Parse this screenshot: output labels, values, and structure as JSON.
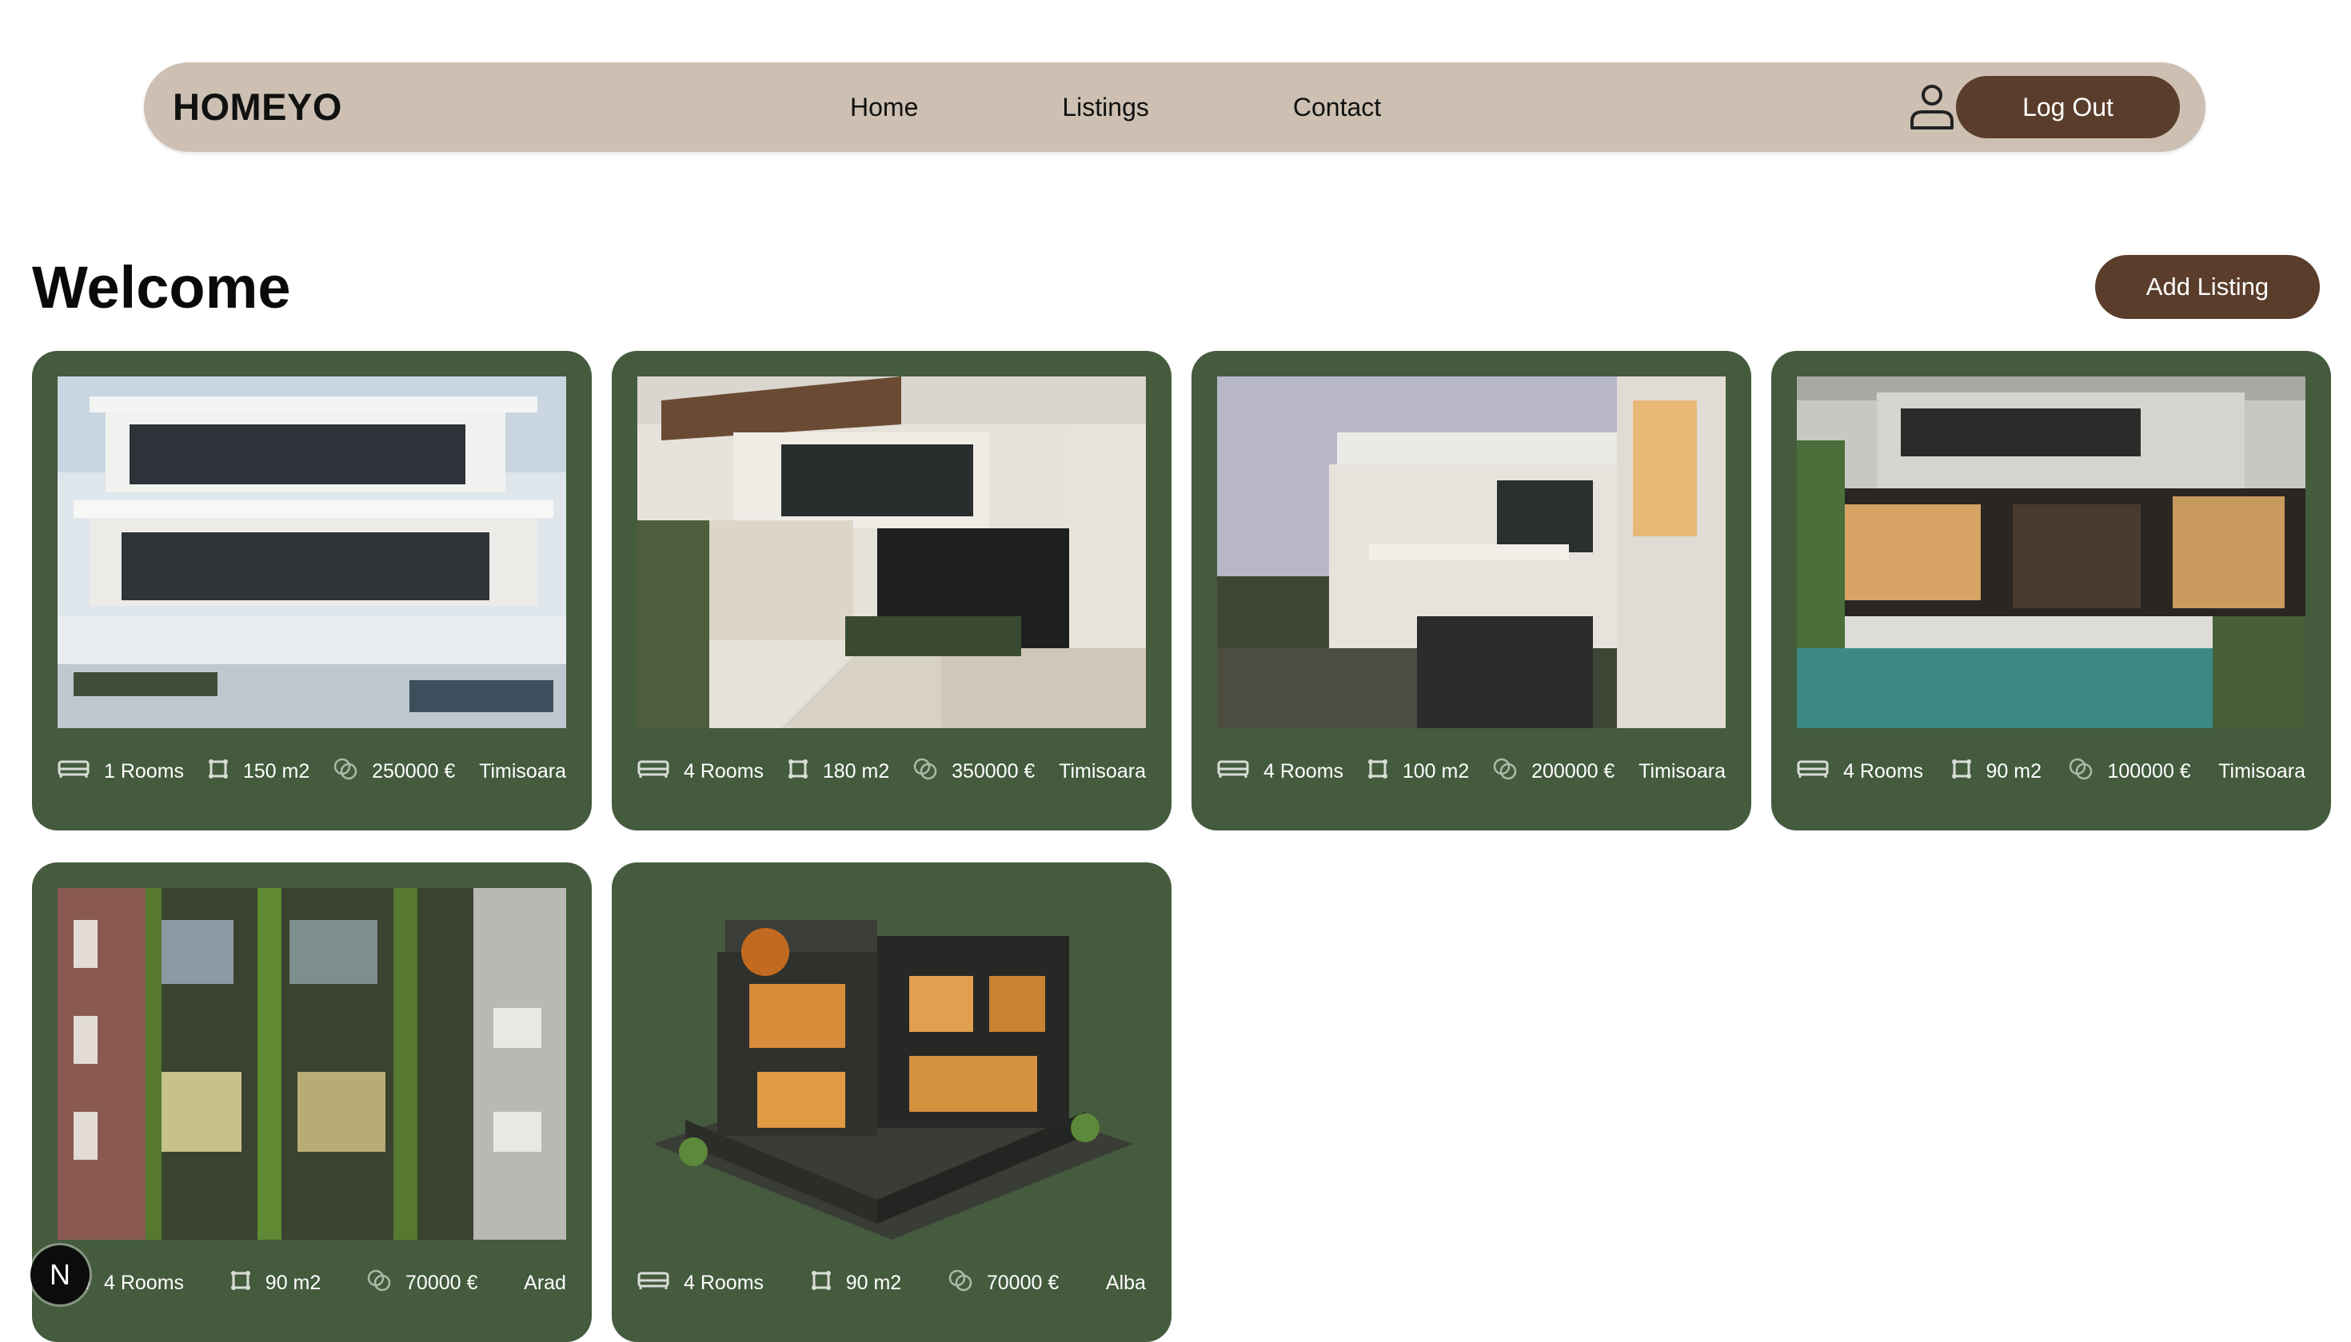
{
  "brand": {
    "name": "HOMEYO"
  },
  "nav": {
    "links": [
      "Home",
      "Listings",
      "Contact"
    ],
    "logout_label": "Log Out"
  },
  "page": {
    "title": "Welcome",
    "add_listing_label": "Add Listing"
  },
  "listings": [
    {
      "rooms": "1 Rooms",
      "area": "150 m2",
      "price": "250000 €",
      "city": "Timisoara"
    },
    {
      "rooms": "4 Rooms",
      "area": "180 m2",
      "price": "350000 €",
      "city": "Timisoara"
    },
    {
      "rooms": "4 Rooms",
      "area": "100 m2",
      "price": "200000 €",
      "city": "Timisoara"
    },
    {
      "rooms": "4 Rooms",
      "area": "90 m2",
      "price": "100000 €",
      "city": "Timisoara"
    },
    {
      "rooms": "4 Rooms",
      "area": "90 m2",
      "price": "70000 €",
      "city": "Arad"
    },
    {
      "rooms": "4 Rooms",
      "area": "90 m2",
      "price": "70000 €",
      "city": "Alba"
    }
  ],
  "icons": {
    "rooms": "bed-icon",
    "area": "area-icon",
    "price": "coins-icon",
    "user": "user-icon"
  },
  "colors": {
    "navbar_bg": "#cdc0b2",
    "button_bg": "#5a3d2b",
    "card_bg": "#445b3e"
  },
  "dev_badge": {
    "label": "N"
  }
}
